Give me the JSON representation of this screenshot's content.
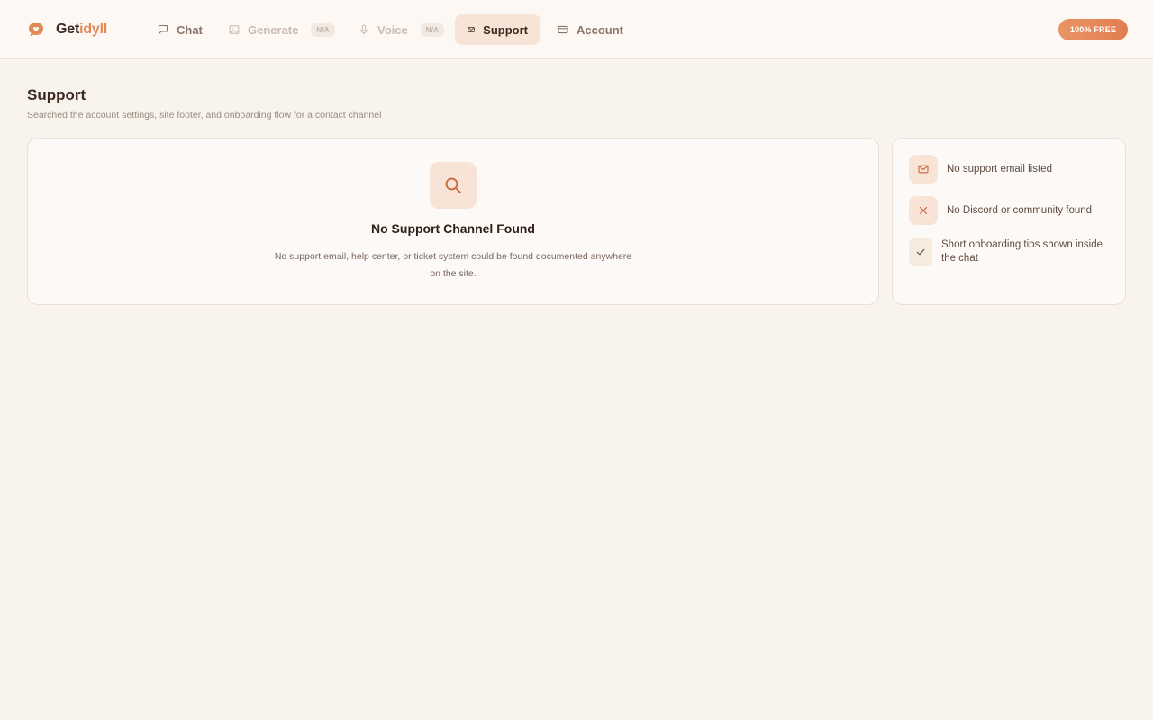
{
  "brand": {
    "name_part1": "Get",
    "name_part2": "idyll",
    "icon": "chat-bubble-heart-icon"
  },
  "nav": {
    "items": [
      {
        "label": "Chat",
        "icon": "chat-icon",
        "state": "enabled"
      },
      {
        "label": "Generate",
        "icon": "image-icon",
        "state": "disabled",
        "badge": "N/A"
      },
      {
        "label": "Voice",
        "icon": "microphone-icon",
        "state": "disabled",
        "badge": "N/A"
      },
      {
        "label": "Support",
        "icon": "mail-icon",
        "state": "active"
      },
      {
        "label": "Account",
        "icon": "card-icon",
        "state": "enabled"
      }
    ],
    "pill": "100% FREE"
  },
  "page": {
    "title": "Support",
    "subtitle": "Searched the account settings, site footer, and onboarding flow for a contact channel"
  },
  "empty_state": {
    "icon": "search-icon",
    "title": "No Support Channel Found",
    "description": "No support email, help center, or ticket system could be found documented anywhere on the site."
  },
  "findings": [
    {
      "icon": "mail-icon",
      "text": "No support email listed"
    },
    {
      "icon": "close-icon",
      "text": "No Discord or community found"
    },
    {
      "icon": "check-icon",
      "text": "Short onboarding tips shown inside the chat"
    }
  ],
  "colors": {
    "accent": "#e08a55",
    "background": "#f9f3ee",
    "active_nav_bg": "#f8e4d6",
    "pill_gradient_start": "#ea9466",
    "pill_gradient_end": "#e07e4f"
  }
}
